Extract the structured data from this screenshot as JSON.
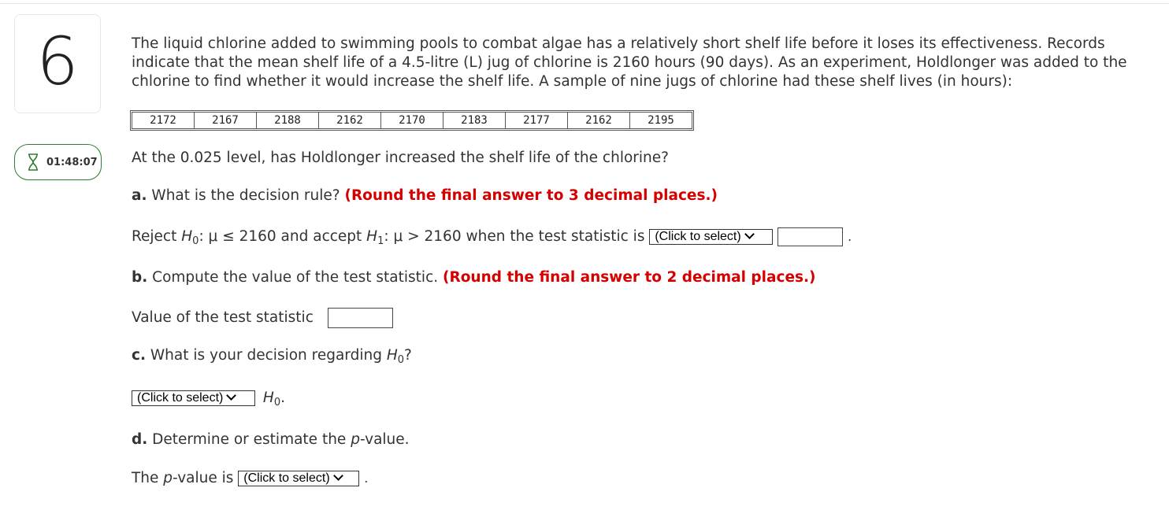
{
  "question_number": "6",
  "timer": "01:48:07",
  "stem": "The liquid chlorine added to swimming pools to combat algae has a relatively short shelf life before it loses its effectiveness. Records indicate that the mean shelf life of a 4.5-litre (L) jug of chlorine is 2160 hours (90 days). As an experiment, Holdlonger was added to the chlorine to find whether it would increase the shelf life. A sample of nine jugs of chlorine had these shelf lives (in hours):",
  "data_values": [
    "2172",
    "2167",
    "2188",
    "2162",
    "2170",
    "2183",
    "2177",
    "2162",
    "2195"
  ],
  "prompt": "At the 0.025 level, has Holdlonger increased the shelf life of the chlorine?",
  "part_a": {
    "label": "a.",
    "text": " What is the decision rule? ",
    "instruction": "(Round the final answer to 3 decimal places.)",
    "reject": "Reject ",
    "h0_symbol": "H",
    "h0_sub": "0",
    "h0_cond": ": μ ≤ 2160 and accept ",
    "h1_symbol": "H",
    "h1_sub": "1",
    "h1_cond": ": μ > 2160 when the test statistic is ",
    "select": "(Click to select)",
    "end": "."
  },
  "part_b": {
    "label": "b.",
    "text": " Compute the value of the test statistic. ",
    "instruction": "(Round the final answer to 2 decimal places.)",
    "field_label": "Value of the test statistic"
  },
  "part_c": {
    "label": "c.",
    "text": " What is your decision regarding ",
    "h0_symbol": "H",
    "h0_sub": "0",
    "q": "?",
    "select": "(Click to select)",
    "end_symbol": "H",
    "end_sub": "0",
    "end": "."
  },
  "part_d": {
    "label": "d.",
    "text1": " Determine or estimate the ",
    "p": "p",
    "text2": "-value.",
    "line_pre": "The ",
    "line_p": "p",
    "line_post": "-value is ",
    "select": "(Click to select)",
    "end": "."
  },
  "colors": {
    "accent_red": "#d40000",
    "timer_border": "#2e7d32"
  }
}
